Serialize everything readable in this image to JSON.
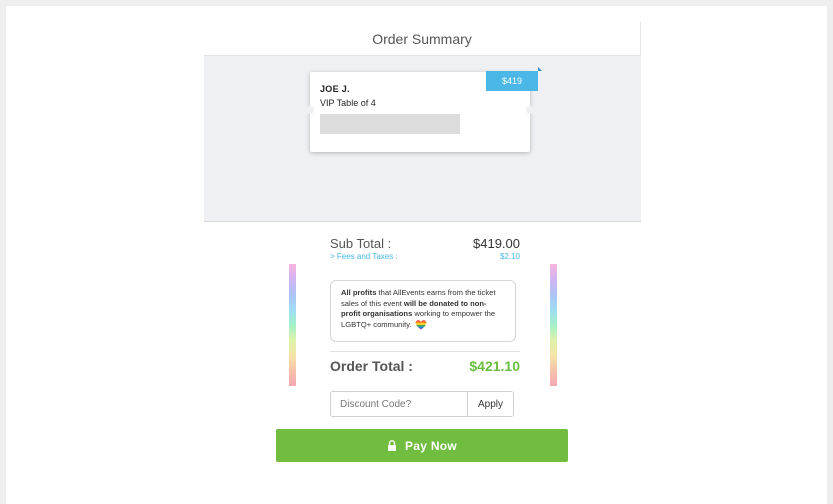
{
  "summary": {
    "title": "Order Summary",
    "ticket": {
      "name": "JOE J.",
      "type": "VIP Table of 4",
      "price_tag": "$419"
    }
  },
  "totals": {
    "subtotal_label": "Sub Total :",
    "subtotal_value": "$419.00",
    "fees_label": "> Fees and Taxes :",
    "fees_value": "$2.10"
  },
  "donation": {
    "part1": "All profits",
    "part2": " that AllEvents earns from the ticket sales of this event ",
    "part3": "will be donated to non-profit organisations",
    "part4": " working to empower the LGBTQ+ community."
  },
  "order_total": {
    "label": "Order Total :",
    "value": "$421.10"
  },
  "discount": {
    "placeholder": "Discount Code?",
    "apply_label": "Apply"
  },
  "pay": {
    "label": "Pay Now",
    "color": "#70bd3f"
  },
  "colors": {
    "accent_blue": "#4ab7e6",
    "total_green": "#6abf3f"
  }
}
